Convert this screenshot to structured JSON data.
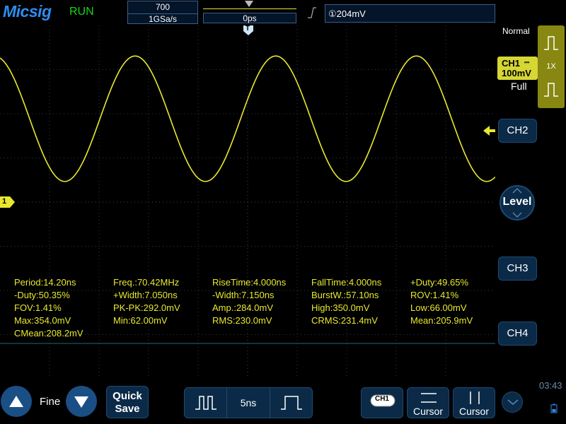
{
  "header": {
    "brand": "Micsig",
    "run_status": "RUN",
    "memory_depth": "700",
    "sample_rate": "1GSa/s",
    "trigger_position": "0ps",
    "trigger_level": "①204mV"
  },
  "waveform": {
    "channel": "CH1",
    "color": "#e8e830",
    "period_ns": 14.2,
    "amplitude_mv": 284.0,
    "offset_mv": 208.0,
    "volts_per_div_mv": 100,
    "time_per_div_ns": 5
  },
  "markers": {
    "ch1_ground_label": "1",
    "trigger_top_label": "T"
  },
  "measurements": [
    {
      "label": "Period:14.20ns"
    },
    {
      "label": "Freq.:70.42MHz"
    },
    {
      "label": "RiseTime:4.000ns"
    },
    {
      "label": "FallTime:4.000ns"
    },
    {
      "label": "+Duty:49.65%"
    },
    {
      "label": "-Duty:50.35%"
    },
    {
      "label": "+Width:7.050ns"
    },
    {
      "label": "-Width:7.150ns"
    },
    {
      "label": "BurstW.:57.10ns"
    },
    {
      "label": "ROV:1.41%"
    },
    {
      "label": "FOV:1.41%"
    },
    {
      "label": "PK-PK:292.0mV"
    },
    {
      "label": "Amp.:284.0mV"
    },
    {
      "label": "High:350.0mV"
    },
    {
      "label": "Low:66.00mV"
    },
    {
      "label": "Max:354.0mV"
    },
    {
      "label": "Min:62.00mV"
    },
    {
      "label": "RMS:230.0mV"
    },
    {
      "label": "CRMS:231.4mV"
    },
    {
      "label": "Mean:205.9mV"
    },
    {
      "label": "CMean:208.2mV"
    }
  ],
  "right_panel": {
    "acq_mode": "Normal",
    "ch1_name": "CH1",
    "ch1_coupling": "⎓",
    "ch1_scale": "100mV",
    "ch1_bandwidth": "Full",
    "probe_ratio": "1X",
    "ch2_label": "CH2",
    "level_label": "Level",
    "ch3_label": "CH3",
    "ch4_label": "CH4"
  },
  "bottom_bar": {
    "fine_label": "Fine",
    "quick_save_line1": "Quick",
    "quick_save_line2": "Save",
    "timebase": "5ns",
    "ch1_button_label": "CH1",
    "cursor_h_label": "Cursor",
    "cursor_v_label": "Cursor",
    "clock": "03:43"
  }
}
